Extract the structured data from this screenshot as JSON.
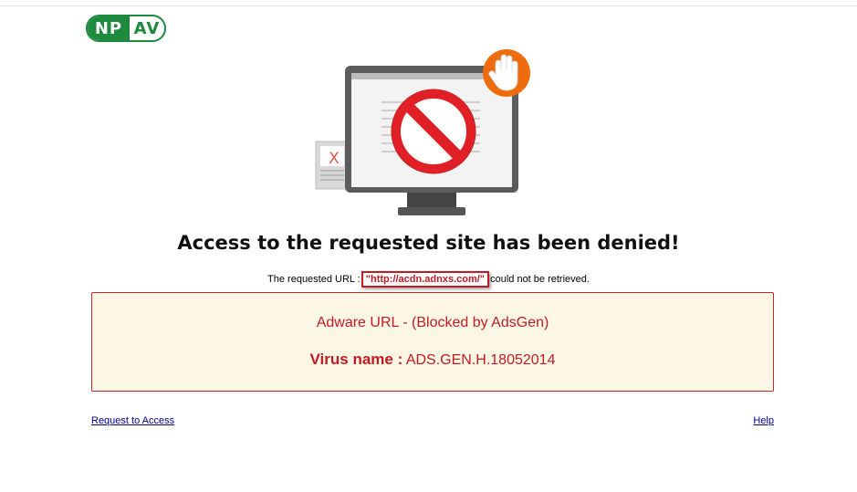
{
  "logo": {
    "part1": "NP",
    "part2": "AV"
  },
  "heading": "Access to the requested site has been denied!",
  "url_message": {
    "prefix": "The requested URL :",
    "url": "\"http://acdn.adnxs.com/\"",
    "suffix": "could not be retrieved."
  },
  "alert": {
    "category": "Adware URL - (Blocked by AdsGen)",
    "virus_label": "Virus name :",
    "virus_name": "ADS.GEN.H.18052014"
  },
  "links": {
    "request_access": "Request to Access",
    "help": "Help"
  },
  "colors": {
    "brand_green": "#1e8a3e",
    "alert_red": "#c21b24",
    "alert_bg": "#fcf7e5",
    "hand_badge": "#ef6c0e"
  },
  "illustration": {
    "small_doc_mark": "X",
    "icons": [
      "monitor-icon",
      "prohibited-icon",
      "stop-hand-icon",
      "error-document-icon"
    ]
  }
}
